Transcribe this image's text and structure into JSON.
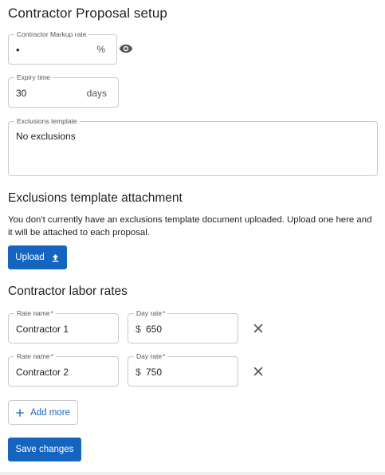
{
  "page": {
    "title": "Contractor Proposal setup"
  },
  "markup": {
    "label": "Contractor Markup rate",
    "value": "•",
    "suffix": "%",
    "toggle_icon": "eye-icon"
  },
  "expiry": {
    "label": "Expiry time",
    "value": "30",
    "suffix": "days"
  },
  "exclusions": {
    "label": "Exclusions template",
    "value": "No exclusions"
  },
  "attachment": {
    "heading": "Exclusions template attachment",
    "description": "You don't currently have an exclusions template document uploaded. Upload one here and it will be attached to each proposal.",
    "upload_label": "Upload"
  },
  "labor": {
    "heading": "Contractor labor rates",
    "name_label": "Rate name",
    "rate_label": "Day rate",
    "required_mark": "*",
    "currency": "$",
    "rates": [
      {
        "name": "Contractor 1",
        "day_rate": "650"
      },
      {
        "name": "Contractor 2",
        "day_rate": "750"
      }
    ],
    "add_more_label": "Add more"
  },
  "footer": {
    "save_label": "Save changes"
  },
  "colors": {
    "primary": "#1565c0",
    "required": "#d32f2f",
    "border": "#c9c9c9"
  }
}
